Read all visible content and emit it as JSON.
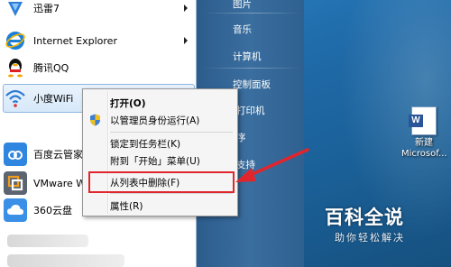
{
  "start_menu": {
    "programs": [
      {
        "label": "迅雷7",
        "icon": "thunder-icon",
        "has_submenu": true
      },
      {
        "label": "Internet Explorer",
        "icon": "internet-explorer-icon",
        "has_submenu": true
      },
      {
        "label": "腾讯QQ",
        "icon": "qq-penguin-icon",
        "has_submenu": false
      },
      {
        "label": "小度WiFi",
        "icon": "wifi-icon",
        "has_submenu": false,
        "highlighted": true
      },
      {
        "label": "百度云管家",
        "icon": "baidu-cloud-icon",
        "has_submenu": false
      },
      {
        "label": "VMware W",
        "icon": "vmware-icon",
        "has_submenu": false
      },
      {
        "label": "360云盘",
        "icon": "360-cloud-icon",
        "has_submenu": false
      }
    ],
    "right_items": [
      "图片",
      "音乐",
      "计算机",
      "控制面板",
      "打印机",
      "序",
      "支持"
    ]
  },
  "context_menu": {
    "items": [
      {
        "label": "打开(O)",
        "bold": true
      },
      {
        "label": "以管理员身份运行(A)",
        "icon": "uac-shield-icon"
      },
      {
        "label": "锁定到任务栏(K)"
      },
      {
        "label": "附到「开始」菜单(U)"
      },
      {
        "label": "从列表中删除(F)",
        "highlighted": true
      },
      {
        "label": "属性(R)"
      }
    ]
  },
  "desktop": {
    "icon_label_line1": "新建",
    "icon_label_line2": "Microsof..."
  },
  "watermark": {
    "title": "百科全说",
    "subtitle": "助你轻松解决"
  },
  "colors": {
    "highlight_border": "#e0262c",
    "annotation_arrow": "#e0262c",
    "desktop_blue": "#1f6aa8"
  }
}
